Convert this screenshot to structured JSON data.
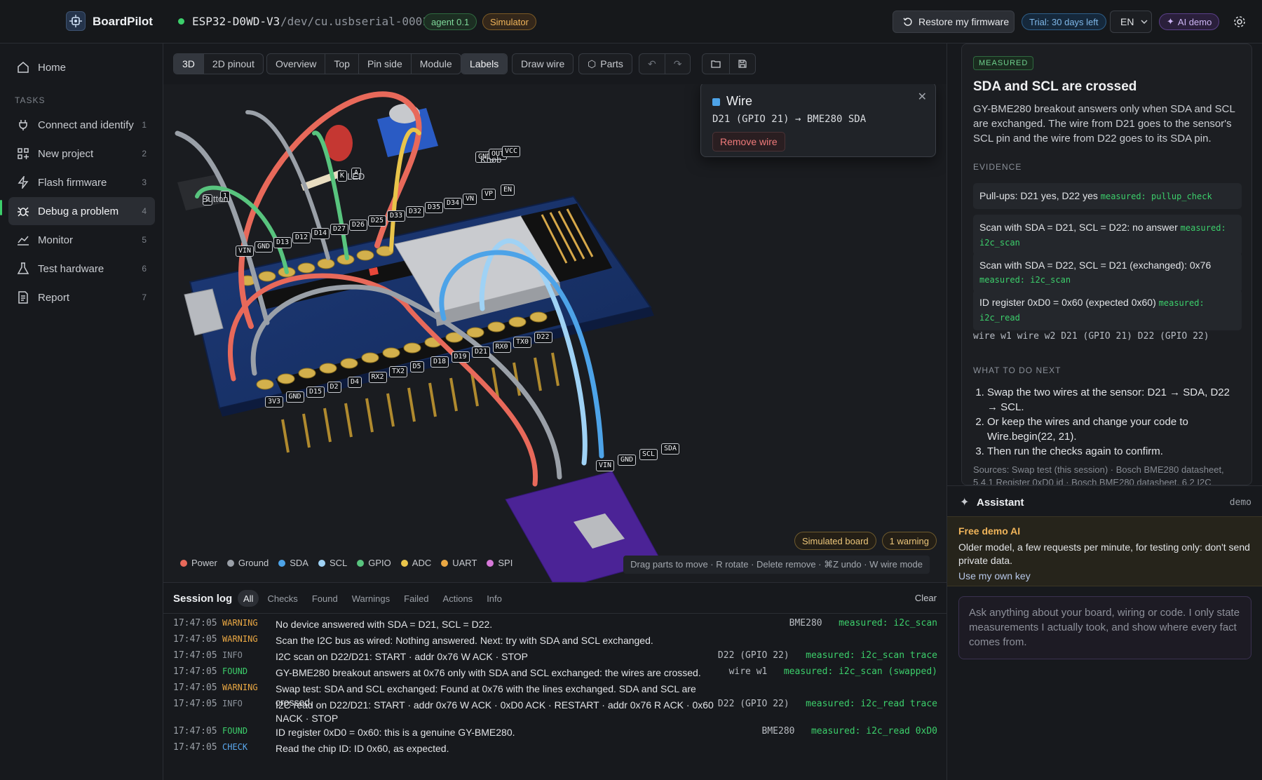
{
  "header": {
    "app_name": "BoardPilot",
    "device_name": "ESP32-D0WD-V3",
    "device_port": "/dev/cu.usbserial-0001",
    "agent_badge": "agent 0.1",
    "simulator_badge": "Simulator",
    "restore_label": "Restore my firmware",
    "trial_badge": "Trial: 30 days left",
    "language": "EN",
    "ai_demo_label": "AI demo"
  },
  "sidebar": {
    "home_label": "Home",
    "tasks_title": "TASKS",
    "items": [
      {
        "label": "Connect and identify",
        "num": "1"
      },
      {
        "label": "New project",
        "num": "2"
      },
      {
        "label": "Flash firmware",
        "num": "3"
      },
      {
        "label": "Debug a problem",
        "num": "4"
      },
      {
        "label": "Monitor",
        "num": "5"
      },
      {
        "label": "Test hardware",
        "num": "6"
      },
      {
        "label": "Report",
        "num": "7"
      }
    ]
  },
  "toolbar": {
    "view_3d": "3D",
    "view_2d": "2D pinout",
    "overview": "Overview",
    "top": "Top",
    "pin_side": "Pin side",
    "module": "Module",
    "labels": "Labels",
    "draw_wire": "Draw wire",
    "parts": "Parts"
  },
  "viewport": {
    "popup_title": "Wire",
    "popup_desc": "D21 (GPIO 21) → BME280 SDA",
    "remove_wire": "Remove wire",
    "simulated_badge": "Simulated board",
    "warning_badge": "1 warning",
    "hint": "Drag parts to move · R rotate · Delete remove · ⌘Z undo · W wire mode",
    "legend": [
      {
        "label": "Power",
        "color": "#e8695a"
      },
      {
        "label": "Ground",
        "color": "#9aa0a8"
      },
      {
        "label": "SDA",
        "color": "#4da3e8"
      },
      {
        "label": "SCL",
        "color": "#9fd2f5"
      },
      {
        "label": "GPIO",
        "color": "#58c47e"
      },
      {
        "label": "ADC",
        "color": "#e9c44a"
      },
      {
        "label": "UART",
        "color": "#e9a743"
      },
      {
        "label": "SPI",
        "color": "#d779d9"
      }
    ],
    "part_labels": {
      "button": "Button",
      "led": "LED",
      "knob": "Knob"
    },
    "pins_top": [
      "VIN",
      "GND",
      "D13",
      "D12",
      "D14",
      "D27",
      "D26",
      "D25",
      "D33",
      "D32",
      "D35",
      "D34",
      "VN",
      "VP",
      "EN"
    ],
    "pins_bottom": [
      "3V3",
      "GND",
      "D15",
      "D2",
      "D4",
      "RX2",
      "TX2",
      "D5",
      "D18",
      "D19",
      "D21",
      "RX0",
      "TX0",
      "D22"
    ],
    "sensor_pins": [
      "VIN",
      "GND",
      "SCL",
      "SDA"
    ],
    "knob_pins": [
      "GND",
      "OUT",
      "VCC"
    ],
    "led_pins": [
      "K",
      "A"
    ],
    "button_pins": [
      "2",
      "1"
    ]
  },
  "log": {
    "title": "Session log",
    "tabs": [
      "All",
      "Checks",
      "Found",
      "Warnings",
      "Failed",
      "Actions",
      "Info"
    ],
    "clear": "Clear",
    "rows": [
      {
        "time": "17:47:05",
        "level": "WARNING",
        "msg": "No device answered with SDA = D21, SCL = D22.",
        "ref": "BME280",
        "tag": "measured: i2c_scan"
      },
      {
        "time": "17:47:05",
        "level": "WARNING",
        "msg": "Scan the I2C bus as wired: Nothing answered. Next: try with SDA and SCL exchanged.",
        "ref": "",
        "tag": ""
      },
      {
        "time": "17:47:05",
        "level": "INFO",
        "msg": "I2C scan on D22/D21: START · addr 0x76 W ACK · STOP",
        "ref": "D22 (GPIO 22)",
        "tag": "measured: i2c_scan trace"
      },
      {
        "time": "17:47:05",
        "level": "FOUND",
        "msg": "GY-BME280 breakout answers at 0x76 only with SDA and SCL exchanged: the wires are crossed.",
        "ref": "wire w1",
        "tag": "measured: i2c_scan (swapped)"
      },
      {
        "time": "17:47:05",
        "level": "WARNING",
        "msg": "Swap test: SDA and SCL exchanged: Found at 0x76 with the lines exchanged. SDA and SCL are crossed.",
        "ref": "",
        "tag": ""
      },
      {
        "time": "17:47:05",
        "level": "INFO",
        "msg": "I2C read on D22/D21: START · addr 0x76 W ACK · 0xD0 ACK · RESTART · addr 0x76 R ACK · 0x60 NACK · STOP",
        "ref": "D22 (GPIO 22)",
        "tag": "measured: i2c_read trace"
      },
      {
        "time": "17:47:05",
        "level": "FOUND",
        "msg": "ID register 0xD0 = 0x60: this is a genuine GY-BME280.",
        "ref": "BME280",
        "tag": "measured: i2c_read 0xD0"
      },
      {
        "time": "17:47:05",
        "level": "CHECK",
        "msg": "Read the chip ID: ID 0x60, as expected.",
        "ref": "",
        "tag": ""
      }
    ]
  },
  "panel": {
    "badge": "MEASURED",
    "title": "SDA and SCL are crossed",
    "body": "GY-BME280 breakout answers only when SDA and SCL are exchanged. The wire from D21 goes to the sensor's SCL pin and the wire from D22 goes to its SDA pin.",
    "evidence_title": "EVIDENCE",
    "evidence": [
      {
        "text": "Pull-ups: D21 yes, D22 yes",
        "tag": "measured: pullup_check"
      },
      {
        "text": "Scan with SDA = D21, SCL = D22: no answer",
        "tag": "measured: i2c_scan"
      },
      {
        "text": "Scan with SDA = D22, SCL = D21 (exchanged): 0x76",
        "tag": "measured: i2c_scan"
      },
      {
        "text": "ID register 0xD0 = 0x60 (expected 0x60)",
        "tag": "measured: i2c_read"
      }
    ],
    "wire_refs": "wire w1  wire w2  D21 (GPIO 21)  D22 (GPIO 22)",
    "next_title": "WHAT TO DO NEXT",
    "steps": [
      "Swap the two wires at the sensor: D21 → SDA, D22 → SCL.",
      "Or keep the wires and change your code to Wire.begin(22, 21).",
      "Then run the checks again to confirm."
    ],
    "sources": "Sources: Swap test (this session) · Bosch BME280 datasheet, 5.4.1 Register 0xD0 id · Bosch BME280 datasheet, 6.2 I2C",
    "assistant_title": "Assistant",
    "assistant_mode": "demo",
    "demo_title": "Free demo AI",
    "demo_text": "Older model, a few requests per minute, for testing only: don't send private data.",
    "own_key": "Use my own key",
    "ask_placeholder": "Ask anything about your board, wiring or code. I only state measurements I actually took, and show where every fact comes from."
  }
}
